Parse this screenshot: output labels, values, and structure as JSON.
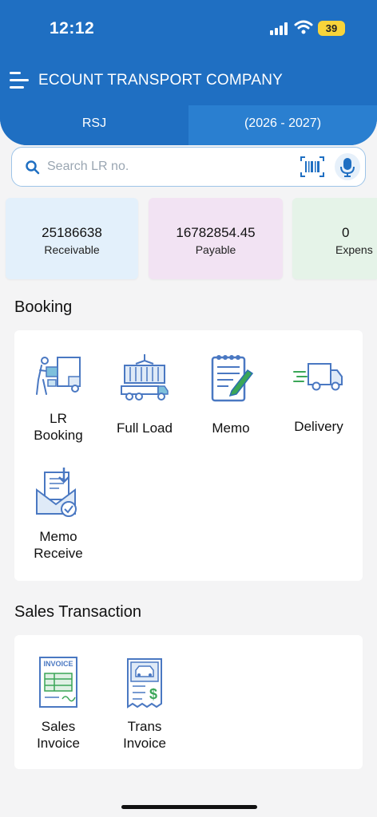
{
  "status_bar": {
    "time": "12:12",
    "battery": "39"
  },
  "header": {
    "company_name": "ECOUNT TRANSPORT COMPANY"
  },
  "tabs": [
    {
      "label": "RSJ"
    },
    {
      "label": "(2026 - 2027)"
    }
  ],
  "search": {
    "placeholder": "Search LR no."
  },
  "summary_cards": [
    {
      "value": "25186638",
      "label": "Receivable",
      "color": "#e3f0fb"
    },
    {
      "value": "16782854.45",
      "label": "Payable",
      "color": "#f2e3f3"
    },
    {
      "value": "0",
      "label": "Expens",
      "color": "#e5f3e8"
    }
  ],
  "booking": {
    "title": "Booking",
    "items": [
      {
        "label": "LR\nBooking",
        "icon": "lr-booking-icon"
      },
      {
        "label": "Full Load",
        "icon": "full-load-icon"
      },
      {
        "label": "Memo",
        "icon": "memo-icon"
      },
      {
        "label": "Delivery",
        "icon": "delivery-icon"
      },
      {
        "label": "Memo\nReceive",
        "icon": "memo-receive-icon"
      }
    ]
  },
  "sales": {
    "title": "Sales Transaction",
    "items": [
      {
        "label": "Sales\nInvoice",
        "icon": "sales-invoice-icon",
        "icon_text": "INVOICE"
      },
      {
        "label": "Trans\nInvoice",
        "icon": "trans-invoice-icon"
      }
    ]
  },
  "colors": {
    "primary": "#1f6fc2",
    "accent_green": "#3aa657",
    "icon_blue": "#4a78c2"
  }
}
